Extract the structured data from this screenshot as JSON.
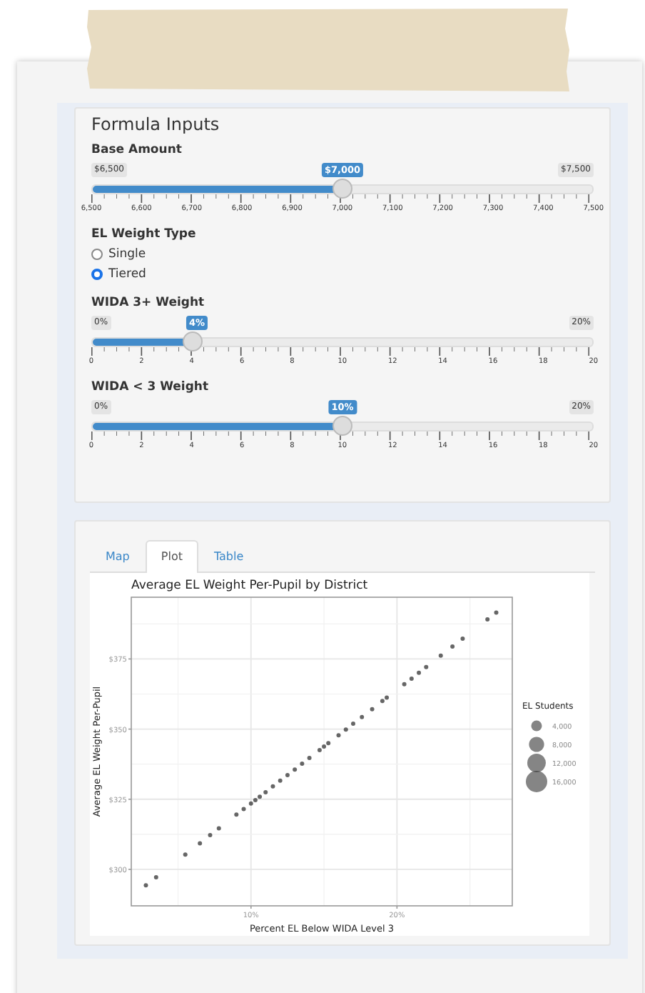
{
  "inputs_panel": {
    "title": "Formula Inputs",
    "controls": [
      {
        "kind": "slider",
        "label": "Base Amount",
        "min_label": "$6,500",
        "max_label": "$7,500",
        "value_label": "$7,000",
        "level": 0.5,
        "ticks": [
          "6,500",
          "6,600",
          "6,700",
          "6,800",
          "6,900",
          "7,000",
          "7,100",
          "7,200",
          "7,300",
          "7,400",
          "7,500"
        ]
      },
      {
        "kind": "radio",
        "label": "EL Weight Type",
        "options": [
          {
            "label": "Single",
            "selected": false
          },
          {
            "label": "Tiered",
            "selected": true
          }
        ]
      },
      {
        "kind": "slider",
        "label": "WIDA 3+ Weight",
        "min_label": "0%",
        "max_label": "20%",
        "value_label": "4%",
        "level": 0.2,
        "ticks": [
          "0",
          "2",
          "4",
          "6",
          "8",
          "10",
          "12",
          "14",
          "16",
          "18",
          "20"
        ]
      },
      {
        "kind": "slider",
        "label": "WIDA < 3 Weight",
        "min_label": "0%",
        "max_label": "20%",
        "value_label": "10%",
        "level": 0.5,
        "ticks": [
          "0",
          "2",
          "4",
          "6",
          "8",
          "10",
          "12",
          "14",
          "16",
          "18",
          "20"
        ]
      }
    ]
  },
  "output_panel": {
    "tabs": [
      {
        "label": "Map",
        "selected": false
      },
      {
        "label": "Plot",
        "selected": true
      },
      {
        "label": "Table",
        "selected": false
      }
    ],
    "chart_data": {
      "type": "scatter",
      "grid": true,
      "title": "Average EL Weight Per-Pupil by District",
      "xlabel": "Percent EL Below WIDA Level 3",
      "ylabel": "Average EL Weight Per-Pupil",
      "xlim": [
        1.8,
        27.9
      ],
      "ylim": [
        287,
        397
      ],
      "xticks": [
        {
          "value": 10,
          "label": "10%"
        },
        {
          "value": 20,
          "label": "20%"
        }
      ],
      "yticks": [
        {
          "value": 300,
          "label": "$300"
        },
        {
          "value": 325,
          "label": "$325"
        },
        {
          "value": 350,
          "label": "$350"
        },
        {
          "value": 375,
          "label": "$375"
        }
      ],
      "x": [
        2.8,
        3.5,
        5.5,
        6.5,
        7.2,
        7.8,
        9,
        9.5,
        10,
        10.3,
        10.6,
        11,
        11.5,
        12,
        12.5,
        13,
        13.5,
        14,
        14.7,
        15,
        15.3,
        16,
        16.5,
        17,
        17.6,
        18.3,
        19,
        19.3,
        20.5,
        21,
        21.5,
        22,
        23,
        23.8,
        24.5,
        26.2,
        26.8
      ],
      "series": [
        {
          "name": "EL Students",
          "color": "#333333",
          "values": [
            294.3,
            297.2,
            305.3,
            309.3,
            312.2,
            314.6,
            319.5,
            321.5,
            323.5,
            324.7,
            325.9,
            327.5,
            329.6,
            331.6,
            333.6,
            335.6,
            337.7,
            339.7,
            342.5,
            343.8,
            345,
            347.8,
            349.8,
            351.9,
            354.3,
            357.1,
            360,
            361.2,
            366,
            368,
            370.1,
            372.1,
            376.2,
            379.4,
            382.2,
            389.1,
            391.5
          ]
        }
      ]
    },
    "size_legend": [
      {
        "label": "4,000"
      },
      {
        "label": "8,000"
      },
      {
        "label": "12,000"
      },
      {
        "label": "16,000"
      }
    ]
  }
}
